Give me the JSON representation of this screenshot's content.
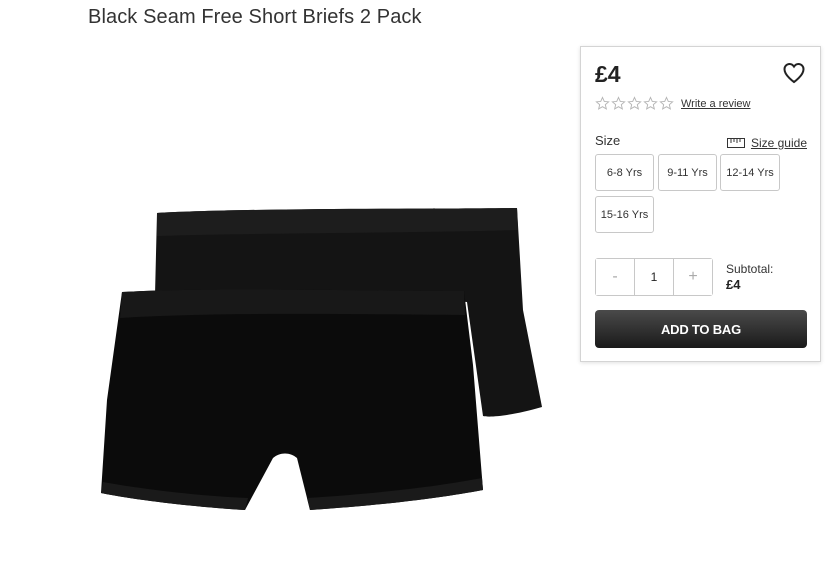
{
  "product": {
    "title": "Black Seam Free Short Briefs 2 Pack",
    "image_icon": "black-briefs-image"
  },
  "buy_box": {
    "price": "£4",
    "wishlist_icon": "heart-icon",
    "rating": {
      "stars": 0,
      "max": 5
    },
    "write_review": "Write a review",
    "size_label": "Size",
    "size_guide": "Size guide",
    "sizes": [
      "6-8 Yrs",
      "9-11 Yrs",
      "12-14 Yrs",
      "15-16 Yrs"
    ],
    "quantity": {
      "minus": "-",
      "value": "1",
      "plus": "+"
    },
    "subtotal_label": "Subtotal:",
    "subtotal_value": "£4",
    "add_to_bag": "ADD TO BAG"
  }
}
